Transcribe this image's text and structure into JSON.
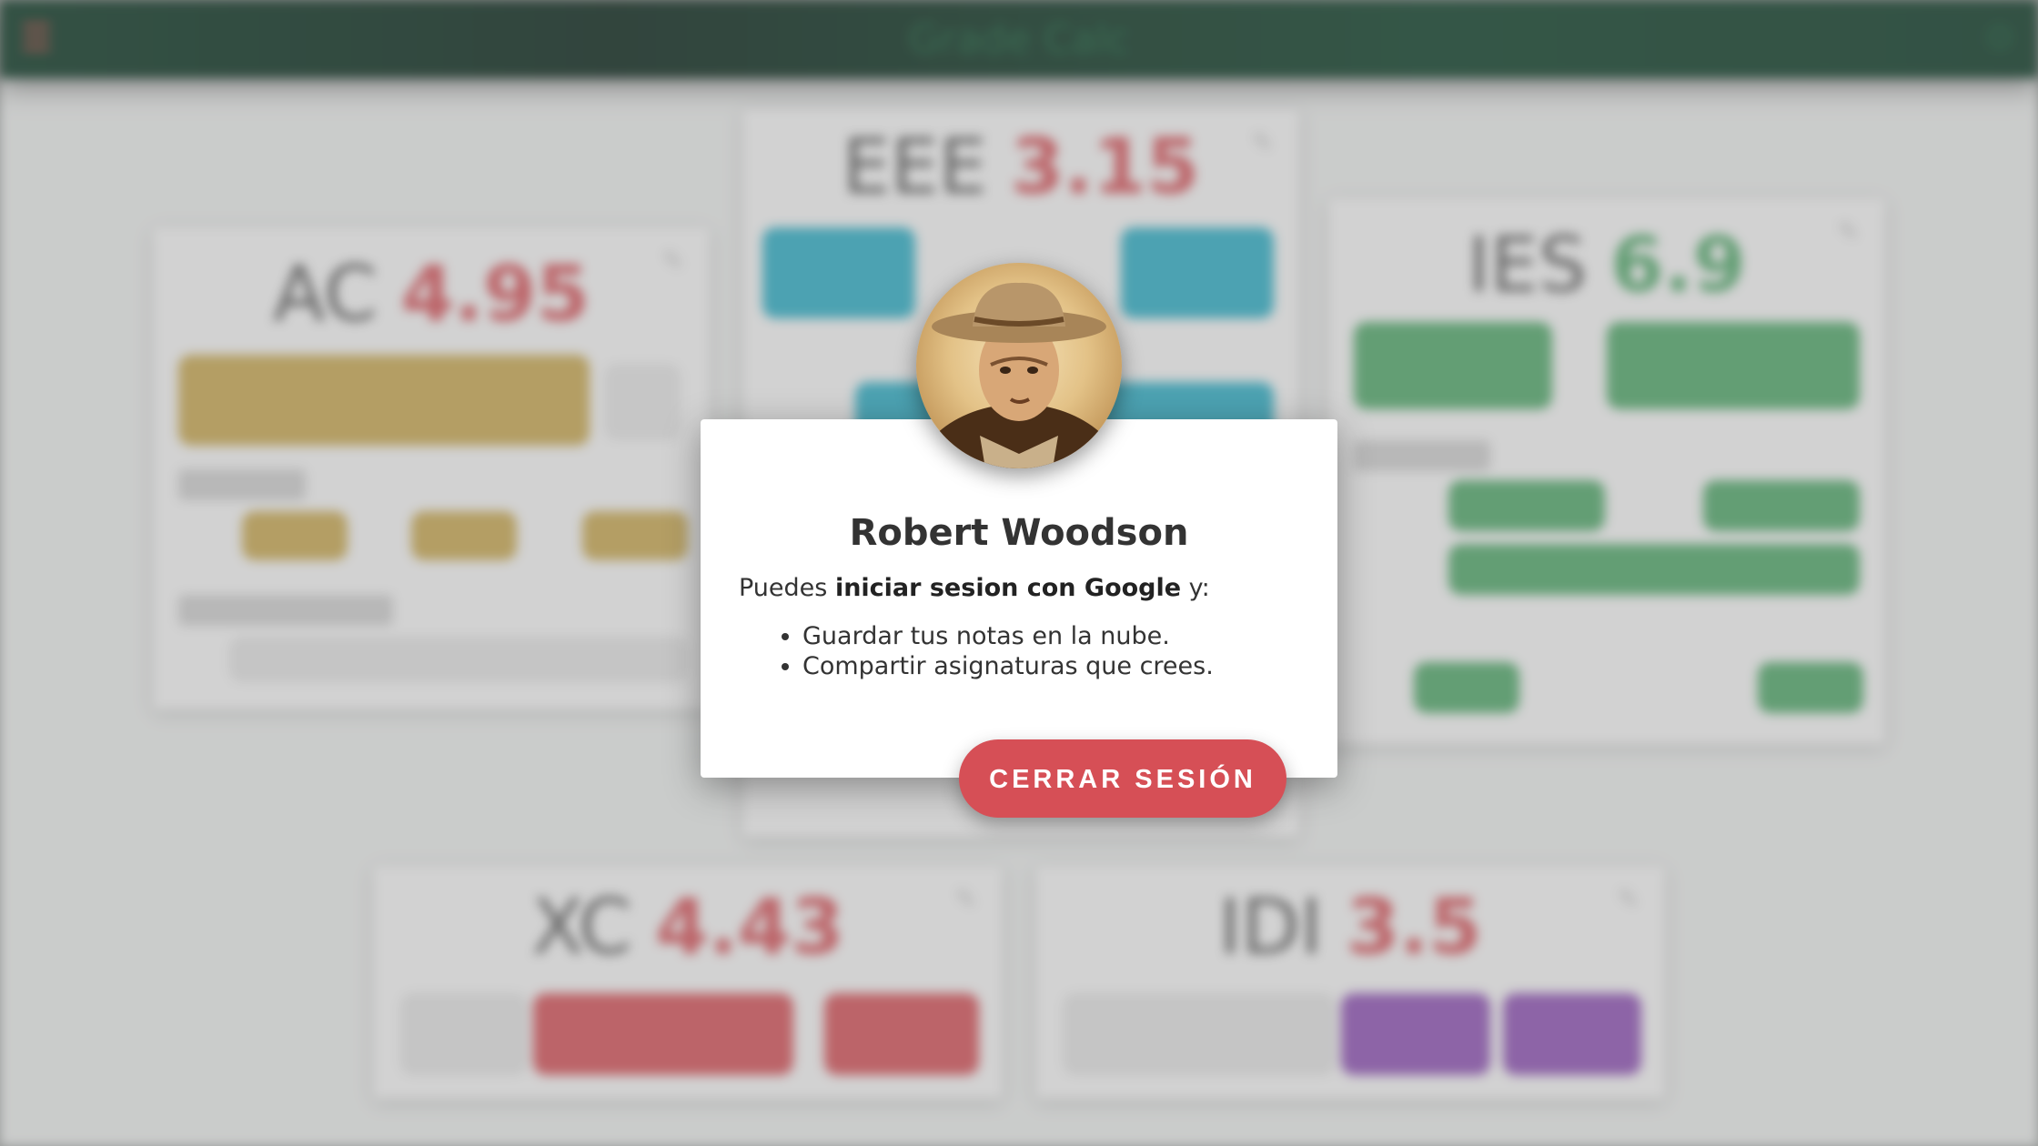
{
  "app": {
    "title": "Grade Calc",
    "menu_icon": "menu-icon",
    "settings_icon": "settings-icon"
  },
  "subjects": [
    {
      "name": "AC",
      "grade": "4.95",
      "color": "#c9a84f",
      "grade_color": "#d64f56"
    },
    {
      "name": "EEE",
      "grade": "3.15",
      "color": "#2aaec6",
      "grade_color": "#d64f56"
    },
    {
      "name": "IES",
      "grade": "6.9",
      "color": "#4ea868",
      "grade_color": "#4ea868"
    },
    {
      "name": "XC",
      "grade": "4.43",
      "color": "#d64f56",
      "grade_color": "#d64f56"
    },
    {
      "name": "IDI",
      "grade": "3.5",
      "color": "#8e4fb5",
      "grade_color": "#d64f56"
    }
  ],
  "dialog": {
    "user_name": "Robert Woodson",
    "intro_prefix": "Puedes ",
    "intro_bold": "iniciar sesion con Google",
    "intro_suffix": " y:",
    "features": [
      "Guardar tus notas en la nube.",
      "Compartir asignaturas que crees."
    ],
    "logout_label": "CERRAR SESIÓN",
    "button_color": "#d64f56"
  }
}
